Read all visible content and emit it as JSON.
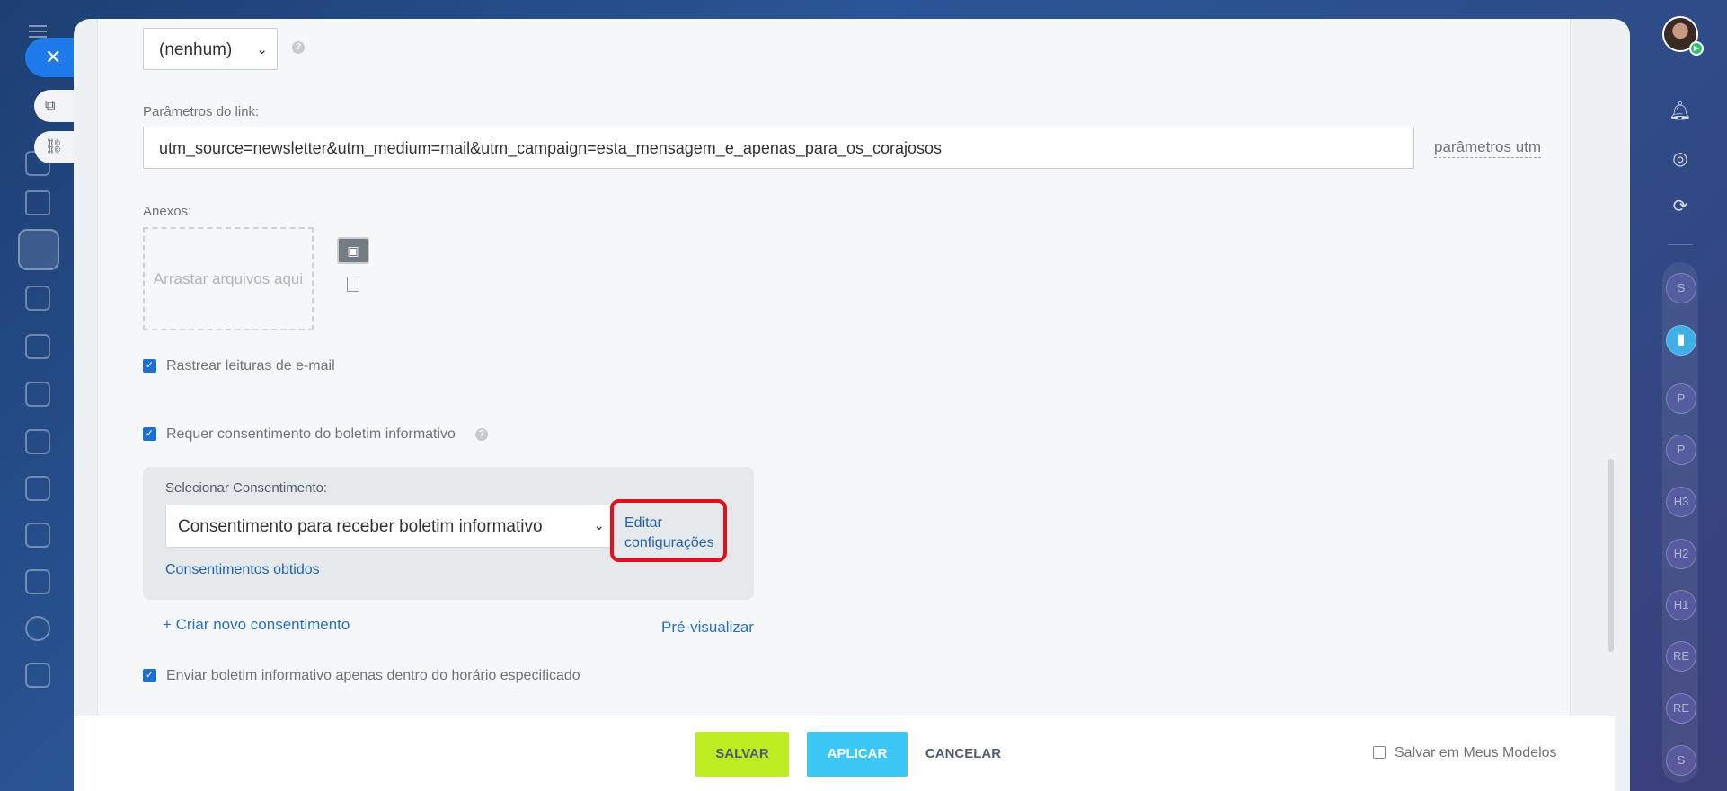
{
  "sender": {
    "selected_value": "(nenhum)"
  },
  "link_params": {
    "label": "Parâmetros do link:",
    "value": "utm_source=newsletter&utm_medium=mail&utm_campaign=esta_mensagem_e_apenas_para_os_corajosos",
    "utm_link": "parâmetros utm"
  },
  "attachments": {
    "label": "Anexos:",
    "dropzone_text": "Arrastar arquivos aqui"
  },
  "options": {
    "track_reads": {
      "label": "Rastrear leituras de e-mail",
      "checked": true
    },
    "require_consent": {
      "label": "Requer consentimento do boletim informativo",
      "checked": true
    },
    "send_in_hours": {
      "label": "Enviar boletim informativo apenas dentro do horário especificado",
      "checked": true
    }
  },
  "consent": {
    "select_label": "Selecionar Consentimento:",
    "selected_value": "Consentimento para receber boletim informativo",
    "edit_link_line1": "Editar",
    "edit_link_line2": "configurações",
    "obtained_link": "Consentimentos obtidos",
    "create_new": "+ Criar novo consentimento",
    "preview": "Pré-visualizar"
  },
  "footer": {
    "save": "SALVAR",
    "apply": "APLICAR",
    "cancel": "CANCELAR",
    "save_template": "Salvar em Meus Modelos"
  },
  "right_bar": {
    "chats": [
      "S",
      "",
      "P",
      "P",
      "H3",
      "H2",
      "H1",
      "RE",
      "RE",
      "S"
    ]
  },
  "icons": {
    "close": "close-icon",
    "help": "help-icon",
    "image": "image-icon",
    "file": "file-icon",
    "bell": "bell-icon"
  },
  "colors": {
    "save_button": "#bbed21",
    "apply_button": "#3bc8f5",
    "highlight_border": "#e0111b",
    "checkbox": "#1d6fd0",
    "link": "#2262a8"
  }
}
